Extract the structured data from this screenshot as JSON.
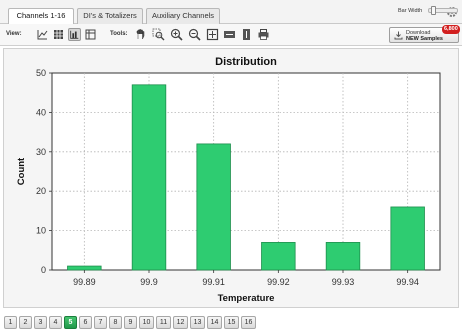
{
  "tabs": [
    {
      "label": "Channels 1-16",
      "active": true
    },
    {
      "label": "DI's & Totalizers",
      "active": false
    },
    {
      "label": "Auxiliary Channels",
      "active": false
    }
  ],
  "toolbar": {
    "view_label": "View:",
    "tools_label": "Tools:",
    "view_icons": [
      "line-chart-icon",
      "grid-icon",
      "bar-chart-icon",
      "table-icon"
    ],
    "selected_view": "bar-chart-icon",
    "tool_icons": [
      "pan-hand-icon",
      "zoom-region-icon",
      "zoom-in-icon",
      "zoom-out-icon",
      "fit-icon",
      "fit-horizontal-icon",
      "fit-vertical-icon",
      "print-icon"
    ],
    "download_line1": "Download",
    "download_line2": "NEW Samples",
    "download_badge": "6,800"
  },
  "chart_data": {
    "type": "bar",
    "title": "Distribution",
    "xlabel": "Temperature",
    "ylabel": "Count",
    "categories": [
      "99.89",
      "99.9",
      "99.91",
      "99.92",
      "99.93",
      "99.94"
    ],
    "values": [
      1,
      47,
      32,
      7,
      7,
      16
    ],
    "ylim": [
      0,
      50
    ],
    "yticks": [
      "0",
      "10",
      "20",
      "30",
      "40",
      "50"
    ],
    "grid": true,
    "bar_color": "#2ecc71"
  },
  "pagination": {
    "pages": [
      "1",
      "2",
      "3",
      "4",
      "5",
      "6",
      "7",
      "8",
      "9",
      "10",
      "11",
      "12",
      "13",
      "14",
      "15",
      "16"
    ],
    "active": "5"
  },
  "bar_width_label": "Bar Width"
}
